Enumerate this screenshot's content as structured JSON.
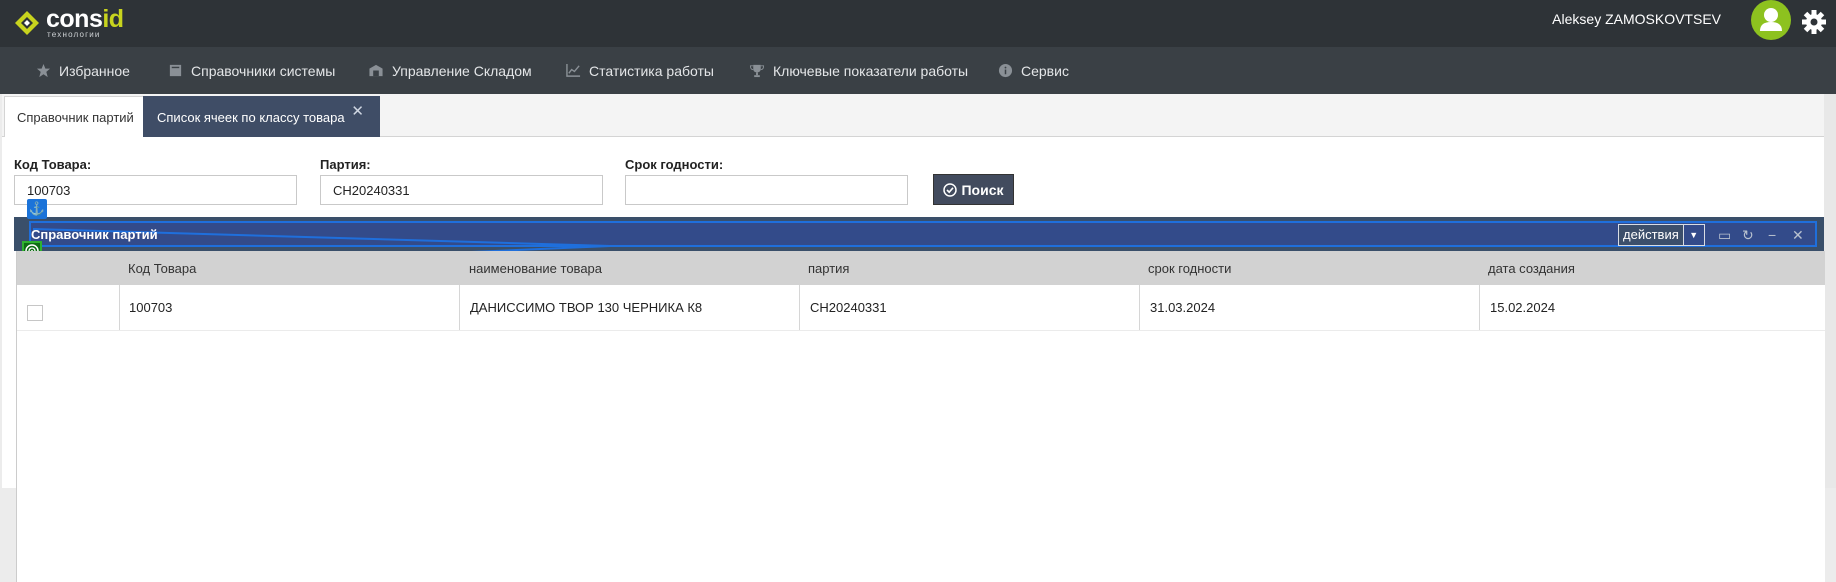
{
  "app": {
    "logo_text_main": "cons",
    "logo_text_accent": "id",
    "logo_subtitle": "технологии",
    "user_name": "Aleksey ZAMOSKOVTSEV"
  },
  "nav": {
    "items": [
      {
        "label": "Избранное",
        "icon": "star-icon"
      },
      {
        "label": "Справочники системы",
        "icon": "book-icon"
      },
      {
        "label": "Управление Складом",
        "icon": "warehouse-icon"
      },
      {
        "label": "Статистика работы",
        "icon": "chart-icon"
      },
      {
        "label": "Ключевые показатели работы",
        "icon": "trophy-icon"
      },
      {
        "label": "Сервис",
        "icon": "info-icon"
      }
    ]
  },
  "tabs": [
    {
      "label": "Справочник партий",
      "active": false
    },
    {
      "label": "Список ячеек по классу товара",
      "active": true,
      "close": "✕"
    }
  ],
  "filters": {
    "product_code": {
      "label": "Код Товара:",
      "value": "100703"
    },
    "batch": {
      "label": "Партия:",
      "value": "СН20240331"
    },
    "expiry": {
      "label": "Срок годности:",
      "value": ""
    },
    "search_label": "Поиск"
  },
  "panel": {
    "title": "Справочник партий",
    "actions_label": "действия"
  },
  "table": {
    "columns": [
      "Код Товара",
      "наименование товара",
      "партия",
      "срок годности",
      "дата создания"
    ],
    "rows": [
      [
        "100703",
        "ДАНИССИМО ТВОР 130 ЧЕРНИКА К8",
        "СН20240331",
        "31.03.2024",
        "15.02.2024"
      ]
    ]
  },
  "colors": {
    "topbar": "#2e3337",
    "navbar": "#3a4045",
    "panel_header": "#3a4f6a",
    "active_tab": "#3f4d66",
    "brand_accent": "#c8d41e",
    "avatar": "#8dc21f",
    "highlight_blue": "#1f6fdc",
    "marker_green": "#2fb22f"
  }
}
